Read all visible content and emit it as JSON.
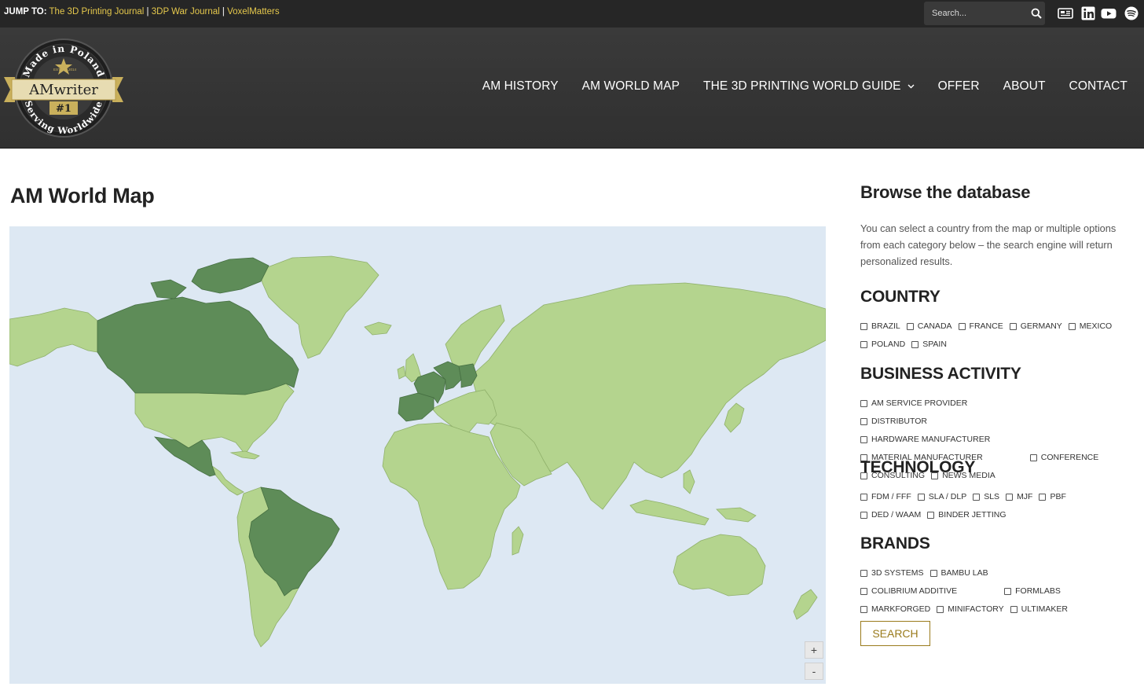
{
  "topbar": {
    "jump_label": "JUMP TO:",
    "links": [
      "The 3D Printing Journal",
      "3DP War Journal",
      "VoxelMatters"
    ],
    "separator": "|",
    "search_placeholder": "Search...",
    "social_icons": [
      "news-icon",
      "linkedin-icon",
      "youtube-icon",
      "spotify-icon"
    ]
  },
  "logo": {
    "top_text": "Made in Poland",
    "bottom_text": "Serving Worldwide",
    "brand": "AMwriter",
    "rank": "#1",
    "year_left": "EST",
    "year_right": "2014"
  },
  "nav": {
    "items": [
      "AM HISTORY",
      "AM WORLD MAP",
      "THE 3D PRINTING WORLD GUIDE",
      "OFFER",
      "ABOUT",
      "CONTACT"
    ]
  },
  "main": {
    "title": "AM World Map",
    "map": {
      "highlighted_countries": [
        "Canada",
        "Mexico",
        "Brazil",
        "Spain",
        "France",
        "Germany",
        "Poland"
      ],
      "zoom_in": "+",
      "zoom_out": "-",
      "colors": {
        "ocean": "#dde8f3",
        "land": "#b4d48e",
        "selected": "#5e8c58"
      }
    }
  },
  "sidebar": {
    "title": "Browse the database",
    "intro": "You can select a country from the map or multiple options from each category below – the search engine will return personalized results.",
    "categories": [
      {
        "title": "COUNTRY",
        "options": [
          "BRAZIL",
          "CANADA",
          "FRANCE",
          "GERMANY",
          "MEXICO",
          "POLAND",
          "SPAIN"
        ]
      },
      {
        "title": "BUSINESS ACTIVITY",
        "options": [
          "AM SERVICE PROVIDER",
          "DISTRIBUTOR",
          "HARDWARE MANUFACTURER",
          "MATERIAL MANUFACTURER",
          "CONFERENCE",
          "CONSULTING",
          "NEWS MEDIA"
        ]
      },
      {
        "title": "TECHNOLOGY",
        "options": [
          "FDM / FFF",
          "SLA / DLP",
          "SLS",
          "MJF",
          "PBF",
          "DED / WAAM",
          "BINDER JETTING"
        ]
      },
      {
        "title": "BRANDS",
        "options": [
          "3D SYSTEMS",
          "BAMBU LAB",
          "COLIBRIUM ADDITIVE",
          "FORMLABS",
          "MARKFORGED",
          "MINIFACTORY",
          "ULTIMAKER"
        ]
      }
    ],
    "search_button": "SEARCH",
    "accent": "#9a7b1c"
  }
}
